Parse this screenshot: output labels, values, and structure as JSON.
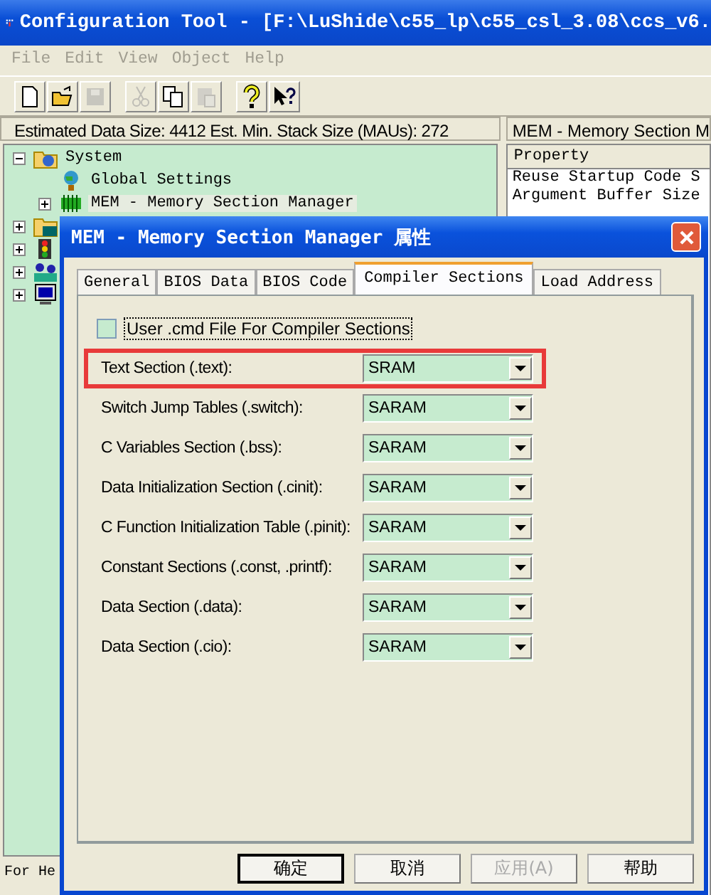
{
  "window": {
    "title": "Configuration Tool - [F:\\LuShide\\c55_lp\\c55_csl_3.08\\ccs_v6."
  },
  "menu": [
    {
      "label": "File"
    },
    {
      "label": "Edit"
    },
    {
      "label": "View"
    },
    {
      "label": "Object"
    },
    {
      "label": "Help"
    }
  ],
  "toolbar": [
    {
      "kind": "new",
      "disabled": false
    },
    {
      "kind": "open",
      "disabled": false
    },
    {
      "kind": "save",
      "disabled": true
    },
    {
      "kind": "sep"
    },
    {
      "kind": "cut",
      "disabled": true
    },
    {
      "kind": "copy",
      "disabled": false
    },
    {
      "kind": "paste",
      "disabled": true
    },
    {
      "kind": "sep"
    },
    {
      "kind": "help",
      "disabled": false
    },
    {
      "kind": "context-help",
      "disabled": false
    }
  ],
  "left_header": "Estimated Data Size: 4412   Est. Min. Stack Size (MAUs): 272",
  "tree": [
    {
      "label": "System",
      "kind": "system",
      "expanded": true,
      "children": [
        {
          "label": "Global Settings",
          "kind": "globe",
          "selected": false
        },
        {
          "label": "MEM - Memory Section Manager",
          "kind": "chip",
          "expanded": false,
          "selected": true
        }
      ]
    },
    {
      "kind": "folder",
      "expanded": false
    },
    {
      "kind": "lights",
      "expanded": false
    },
    {
      "kind": "people",
      "expanded": false
    },
    {
      "kind": "monitor",
      "expanded": false
    }
  ],
  "status_bar": "For He",
  "right_pane": {
    "title": "MEM - Memory Section M",
    "column": "Property",
    "rows": [
      "Reuse Startup Code S",
      "Argument Buffer Size"
    ]
  },
  "dialog": {
    "title": "MEM - Memory Section Manager 属性",
    "tabs": [
      {
        "label": "General",
        "selected": false
      },
      {
        "label": "BIOS Data",
        "selected": false
      },
      {
        "label": "BIOS Code",
        "selected": false
      },
      {
        "label": "Compiler Sections",
        "selected": true
      },
      {
        "label": "Load Address",
        "selected": false
      }
    ],
    "checkbox": {
      "label": "User .cmd File For Compiler Sections",
      "checked": false
    },
    "fields": [
      {
        "label": "Text Section (.text):",
        "value": "SRAM",
        "highlighted": true
      },
      {
        "label": "Switch Jump Tables (.switch):",
        "value": "SARAM",
        "highlighted": false
      },
      {
        "label": "C Variables Section (.bss):",
        "value": "SARAM",
        "highlighted": false
      },
      {
        "label": "Data Initialization Section (.cinit):",
        "value": "SARAM",
        "highlighted": false
      },
      {
        "label": "C Function Initialization Table (.pinit):",
        "value": "SARAM",
        "highlighted": false
      },
      {
        "label": "Constant Sections (.const, .printf):",
        "value": "SARAM",
        "highlighted": false
      },
      {
        "label": "Data Section (.data):",
        "value": "SARAM",
        "highlighted": false
      },
      {
        "label": "Data Section (.cio):",
        "value": "SARAM",
        "highlighted": false
      }
    ],
    "buttons": [
      {
        "label": "确定",
        "default": true,
        "disabled": false
      },
      {
        "label": "取消",
        "default": false,
        "disabled": false
      },
      {
        "label": "应用(A)",
        "default": false,
        "disabled": true
      },
      {
        "label": "帮助",
        "default": false,
        "disabled": false
      }
    ]
  }
}
